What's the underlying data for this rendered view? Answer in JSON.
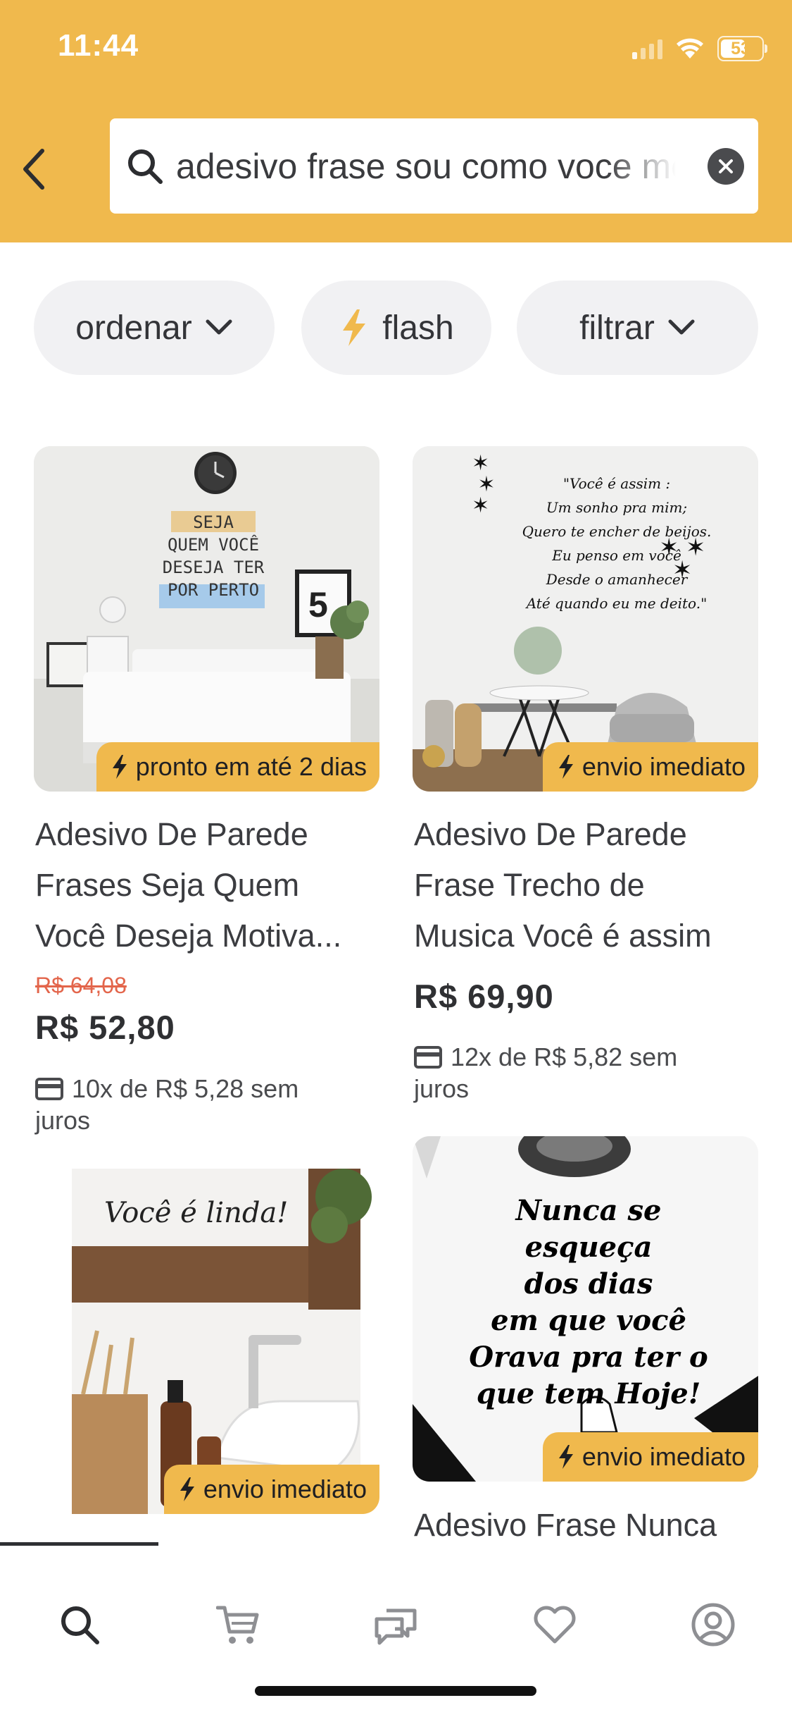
{
  "status_bar": {
    "time": "11:44",
    "battery": "53"
  },
  "header": {
    "search_query": "adesivo frase sou como voce me vê",
    "colors": {
      "brand": "#f0b94d",
      "text": "#ffffff"
    }
  },
  "filters": [
    {
      "label": "ordenar",
      "icon": "chevron-down-icon"
    },
    {
      "label": "flash",
      "icon": "lightning-icon"
    },
    {
      "label": "filtrar",
      "icon": "chevron-down-icon"
    }
  ],
  "products": [
    {
      "badge": "pronto em até 2 dias",
      "title_lines": [
        "Adesivo De Parede",
        "Frases Seja Quem",
        "Você Deseja Motiva..."
      ],
      "old_price": "R$ 64,08",
      "price": "R$ 52,80",
      "installments_line1": "10x de R$ 5,28 sem",
      "installments_line2": "juros",
      "image_text": [
        "SEJA",
        "QUEM VOCÊ",
        "DESEJA TER",
        "POR PERTO"
      ],
      "frame_number": "5"
    },
    {
      "badge": "envio imediato",
      "title_lines": [
        "Adesivo De Parede",
        "Frase Trecho de",
        "Musica Você é assim"
      ],
      "price": "R$ 69,90",
      "installments_line1": "12x de R$ 5,82 sem",
      "installments_line2": "juros",
      "image_text": [
        "\"Você é assim :",
        "Um sonho pra mim;",
        "Quero te encher de beijos.",
        "Eu penso em você",
        "Desde o amanhecer",
        "Até quando eu me deito.\""
      ]
    },
    {
      "badge": "envio imediato",
      "image_text": [
        "Você é linda!"
      ]
    },
    {
      "badge": "envio imediato",
      "title_lines": [
        "Adesivo Frase Nunca"
      ],
      "image_text": [
        "Nunca se esqueça",
        "dos dias",
        "em que você",
        "Orava pra ter o",
        "que tem Hoje!"
      ]
    }
  ],
  "tab_bar": [
    {
      "icon": "search-icon",
      "active": true
    },
    {
      "icon": "cart-icon",
      "active": false
    },
    {
      "icon": "chat-icon",
      "active": false
    },
    {
      "icon": "heart-icon",
      "active": false
    },
    {
      "icon": "profile-icon",
      "active": false
    }
  ]
}
